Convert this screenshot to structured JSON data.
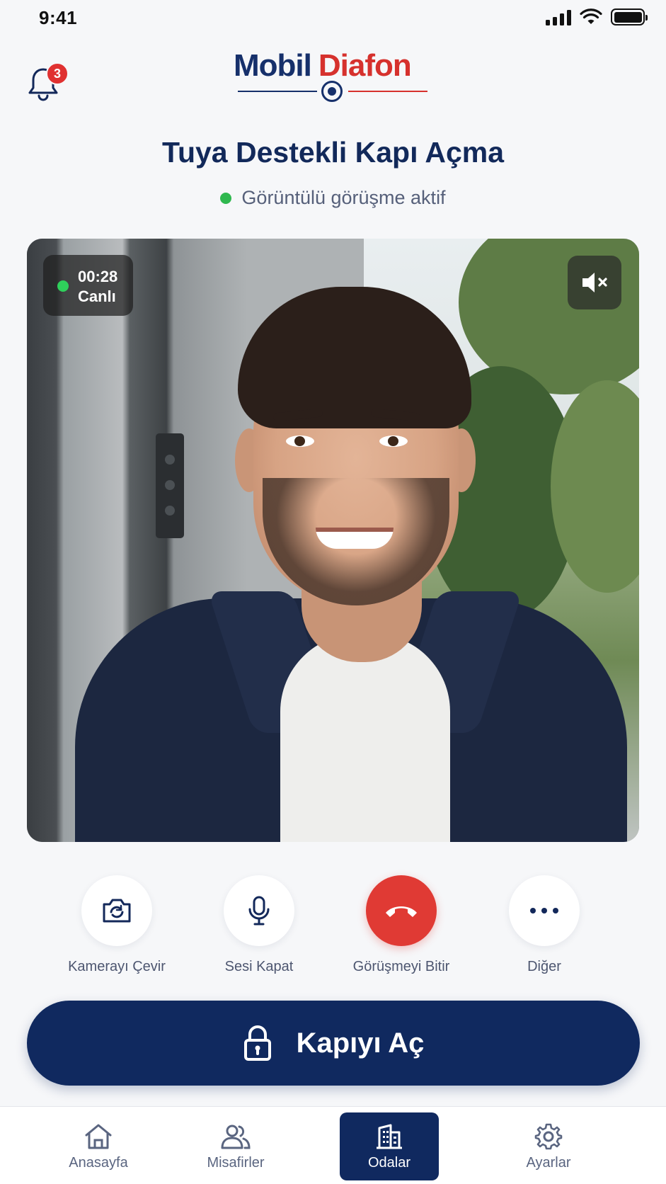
{
  "status_bar": {
    "time": "9:41"
  },
  "header": {
    "notifications_count": "3",
    "logo": {
      "part1": "Mobil",
      "part2": "Diafon"
    }
  },
  "page": {
    "title": "Tuya Destekli Kapı Açma",
    "call_status": "Görüntülü görüşme aktif"
  },
  "video": {
    "timer": "00:28",
    "live_label": "Canlı"
  },
  "controls": [
    {
      "label": "Kamerayı Çevir",
      "icon": "camera-flip-icon"
    },
    {
      "label": "Sesi Kapat",
      "icon": "microphone-icon"
    },
    {
      "label": "Görüşmeyi Bitir",
      "icon": "hang-up-icon"
    },
    {
      "label": "Diğer",
      "icon": "more-icon"
    }
  ],
  "open_door": {
    "label": "Kapıyı Aç"
  },
  "tabs": [
    {
      "label": "Anasayfa",
      "icon": "home-icon"
    },
    {
      "label": "Misafirler",
      "icon": "users-icon"
    },
    {
      "label": "Odalar",
      "icon": "building-icon",
      "active": true
    },
    {
      "label": "Ayarlar",
      "icon": "gear-icon"
    }
  ],
  "colors": {
    "brand_navy": "#10295f",
    "brand_red": "#d6312d",
    "end_call_red": "#e03a34",
    "live_green": "#2fd05b"
  }
}
